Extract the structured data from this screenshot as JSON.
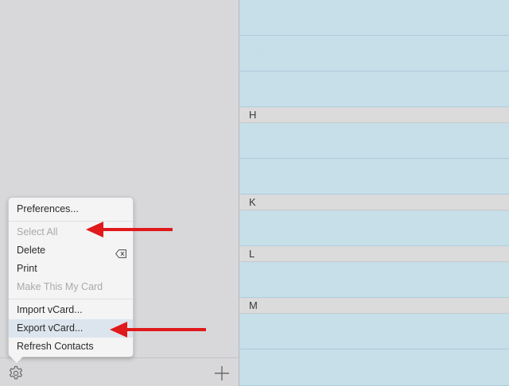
{
  "menu": {
    "items": [
      {
        "label": "Preferences...",
        "enabled": true
      },
      {
        "label": "Select All",
        "enabled": false
      },
      {
        "label": "Delete",
        "enabled": true,
        "shortcut_icon": "delete-key-icon"
      },
      {
        "label": "Print",
        "enabled": true
      },
      {
        "label": "Make This My Card",
        "enabled": false
      },
      {
        "label": "Import vCard...",
        "enabled": true
      },
      {
        "label": "Export vCard...",
        "enabled": true,
        "highlighted": true
      },
      {
        "label": "Refresh Contacts",
        "enabled": true
      }
    ]
  },
  "toolbar": {
    "settings_icon": "gear-icon",
    "add_icon": "plus-icon"
  },
  "contact_list": {
    "sections": [
      {
        "letter": "H"
      },
      {
        "letter": "K"
      },
      {
        "letter": "L"
      },
      {
        "letter": "M"
      }
    ]
  },
  "colors": {
    "list_background": "#c6dfe9",
    "section_header": "#dbdbdc",
    "annotation_arrow": "#e0191b",
    "highlight": "#dce5ee"
  }
}
